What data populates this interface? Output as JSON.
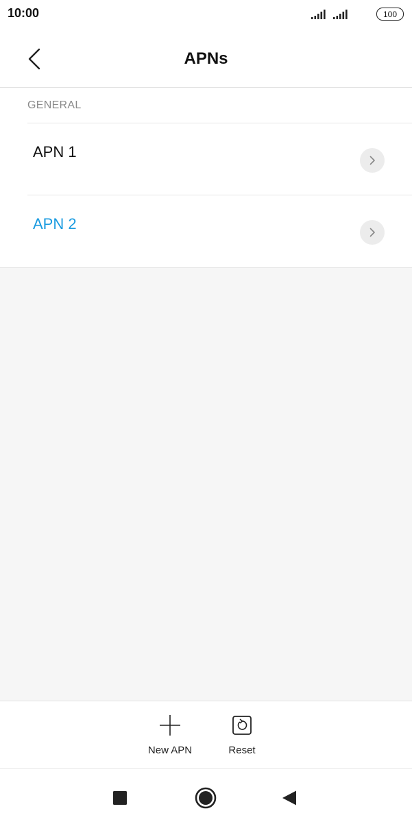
{
  "status_bar": {
    "time": "10:00",
    "battery_level": "100",
    "icons": [
      "signal-icon",
      "signal-icon",
      "battery-icon"
    ]
  },
  "header": {
    "title": "APNs",
    "back_icon": "chevron-left-icon"
  },
  "list": {
    "section_header": "GENERAL",
    "items": [
      {
        "label": "APN 1",
        "selected": false,
        "color": "#111111"
      },
      {
        "label": "APN 2",
        "selected": true,
        "color": "#1a9be0"
      }
    ],
    "item_icon": "chevron-right-icon"
  },
  "toolbar": {
    "new_apn_label": "New APN",
    "reset_label": "Reset",
    "icons": [
      "plus-icon",
      "reset-icon"
    ]
  },
  "nav_bar": {
    "icons": [
      "recents-square-icon",
      "home-circle-icon",
      "back-triangle-icon"
    ]
  },
  "colors": {
    "accent": "#1a9be0",
    "background": "#f6f6f6",
    "surface": "#ffffff",
    "divider": "#e4e4e4"
  }
}
